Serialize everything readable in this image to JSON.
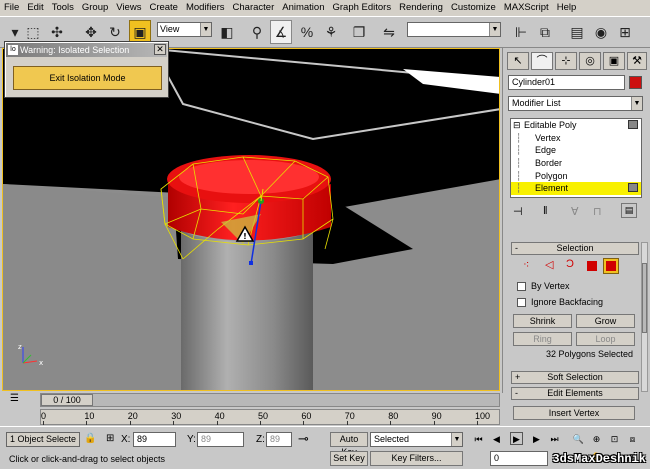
{
  "menu": [
    "File",
    "Edit",
    "Tools",
    "Group",
    "Views",
    "Create",
    "Modifiers",
    "Character",
    "Animation",
    "Graph Editors",
    "Rendering",
    "Customize",
    "MAXScript",
    "Help"
  ],
  "toolbar": {
    "reference_coord_value": "View",
    "selection_set_value": ""
  },
  "warning_dialog": {
    "title": "Warning: Isolated Selection",
    "exit_button": "Exit Isolation Mode",
    "close_glyph": "✕",
    "title_icon_glyph": "lo"
  },
  "command_panel": {
    "object_name": "Cylinder01",
    "object_color": "#cc1010",
    "modifier_list_label": "Modifier List",
    "modifier_stack": [
      {
        "label": "Editable Poly",
        "expander": "⊟",
        "selected": false
      },
      {
        "label": "Vertex",
        "selected": false
      },
      {
        "label": "Edge",
        "selected": false
      },
      {
        "label": "Border",
        "selected": false
      },
      {
        "label": "Polygon",
        "selected": false
      },
      {
        "label": "Element",
        "selected": true
      }
    ],
    "selection_rollout": {
      "title": "Selection",
      "by_vertex_label": "By Vertex",
      "ignore_backfacing_label": "Ignore Backfacing",
      "shrink_label": "Shrink",
      "grow_label": "Grow",
      "ring_label": "Ring",
      "loop_label": "Loop",
      "status_text": "32 Polygons Selected"
    },
    "soft_selection_title": "Soft Selection",
    "edit_elements_title": "Edit Elements",
    "insert_vertex_label": "Insert Vertex",
    "rollout_sign_minus": "-",
    "rollout_sign_plus": "+"
  },
  "timeline": {
    "frame_counter": "0 / 100",
    "ticks": [
      "0",
      "10",
      "20",
      "30",
      "40",
      "50",
      "60",
      "70",
      "80",
      "90",
      "100"
    ]
  },
  "status": {
    "selected_count": "1 Object Selecte",
    "prompt": "Click or click-and-drag to select objects",
    "x_label": "X:",
    "x_value": "89",
    "y_label": "Y:",
    "y_value": "89",
    "z_label": "Z:",
    "z_value": "89",
    "auto_key_label": "Auto Key",
    "set_key_label": "Set Key",
    "key_mode_value": "Selected",
    "key_filters_label": "Key Filters...",
    "current_frame": "0"
  },
  "watermark": "3dsMaxDeshnik",
  "colors": {
    "accent_yellow": "#f0c020",
    "selection_red": "#e81010",
    "viewport_grey": "#8a8a8a"
  }
}
